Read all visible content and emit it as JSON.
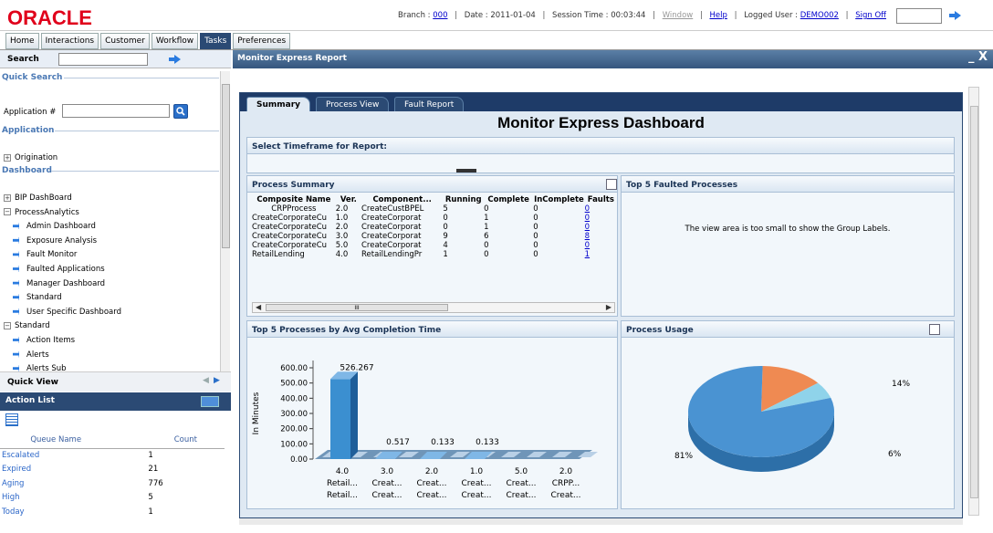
{
  "brand": {
    "logo": "ORACLE"
  },
  "topbar": {
    "branch_label": "Branch :",
    "branch_value": "000",
    "date": "Date : 2011-01-04",
    "session": "Session Time : 00:03:44",
    "window": "Window",
    "help": "Help",
    "logged_user_label": "Logged User :",
    "logged_user": "DEMO002",
    "signoff": "Sign Off",
    "sep": "|"
  },
  "tabs": [
    "Home",
    "Interactions",
    "Customer",
    "Workflow",
    "Tasks",
    "Preferences"
  ],
  "left": {
    "search_label": "Search",
    "quick_search": "Quick Search",
    "application_no": "Application #",
    "application": "Application",
    "origination": "Origination",
    "dashboard": "Dashboard",
    "tree": [
      {
        "label": "BIP DashBoard",
        "kind": "plus"
      },
      {
        "label": "ProcessAnalytics",
        "kind": "minus"
      },
      {
        "label": "Admin Dashboard",
        "kind": "leaf"
      },
      {
        "label": "Exposure Analysis",
        "kind": "leaf"
      },
      {
        "label": "Fault Monitor",
        "kind": "leaf"
      },
      {
        "label": "Faulted Applications",
        "kind": "leaf"
      },
      {
        "label": "Manager Dashboard",
        "kind": "leaf"
      },
      {
        "label": "Standard",
        "kind": "leaf"
      },
      {
        "label": "User Specific Dashboard",
        "kind": "leaf"
      },
      {
        "label": "Standard",
        "kind": "minus"
      },
      {
        "label": "Action Items",
        "kind": "leaf"
      },
      {
        "label": "Alerts",
        "kind": "leaf"
      },
      {
        "label": "Alerts Sub",
        "kind": "leaf"
      }
    ],
    "quick_view": "Quick View",
    "action_list": "Action List",
    "queue_headers": [
      "Queue Name",
      "Count"
    ],
    "queues": [
      [
        "Escalated",
        "1"
      ],
      [
        "Expired",
        "21"
      ],
      [
        "Aging",
        "776"
      ],
      [
        "High",
        "5"
      ],
      [
        "Today",
        "1"
      ]
    ]
  },
  "main": {
    "header": "Monitor Express Report",
    "close": "_ X",
    "dash_tabs": [
      "Summary",
      "Process View",
      "Fault Report"
    ],
    "title": "Monitor Express Dashboard",
    "timeframe": "Select Timeframe for Report:",
    "process_summary": {
      "title": "Process Summary",
      "headers": [
        "Composite Name",
        "Ver.",
        "Component...",
        "Running",
        "Complete",
        "InComplete",
        "Faults"
      ],
      "rows": [
        [
          "CRPProcess",
          "2.0",
          "CreateCustBPEL",
          "5",
          "0",
          "0",
          "0"
        ],
        [
          "CreateCorporateCu",
          "1.0",
          "CreateCorporat",
          "0",
          "1",
          "0",
          "0"
        ],
        [
          "CreateCorporateCu",
          "2.0",
          "CreateCorporat",
          "0",
          "1",
          "0",
          "0"
        ],
        [
          "CreateCorporateCu",
          "3.0",
          "CreateCorporat",
          "9",
          "6",
          "0",
          "8"
        ],
        [
          "CreateCorporateCu",
          "5.0",
          "CreateCorporat",
          "4",
          "0",
          "0",
          "0"
        ],
        [
          "RetailLending",
          "4.0",
          "RetailLendingPr",
          "1",
          "0",
          "0",
          "1"
        ]
      ],
      "hscroll_mark": "III"
    },
    "faulted": {
      "title": "Top 5 Faulted Processes",
      "message": "The view area is too small to show the Group Labels."
    },
    "avg_panel_title": "Top 5 Processes by Avg Completion Time",
    "usage_panel_title": "Process Usage"
  },
  "chart_data": [
    {
      "type": "bar",
      "title": "Top 5 Processes by Avg Completion Time",
      "ylabel": "In Minutes",
      "ylim": [
        0,
        600
      ],
      "yticks": [
        "0.00",
        "100.00",
        "200.00",
        "300.00",
        "400.00",
        "500.00",
        "600.00"
      ],
      "categories": [
        [
          "4.0",
          "Retail...",
          "Retail..."
        ],
        [
          "3.0",
          "Creat...",
          "Creat..."
        ],
        [
          "2.0",
          "Creat...",
          "Creat..."
        ],
        [
          "1.0",
          "Creat...",
          "Creat..."
        ],
        [
          "5.0",
          "Creat...",
          "Creat..."
        ],
        [
          "2.0",
          "CRPP...",
          "Creat..."
        ]
      ],
      "values": [
        526.267,
        0.517,
        0.133,
        0.133,
        0,
        0
      ],
      "labels": [
        "526.267",
        "0.517",
        "0.133",
        "0.133",
        "",
        ""
      ],
      "color": "#3b8fd0"
    },
    {
      "type": "pie",
      "title": "Process Usage",
      "slices": [
        {
          "label": "81%",
          "value": 81,
          "color": "#4a93d2"
        },
        {
          "label": "14%",
          "value": 14,
          "color": "#ef8a52"
        },
        {
          "label": "6%",
          "value": 6,
          "color": "#8fd3ea"
        }
      ]
    }
  ]
}
